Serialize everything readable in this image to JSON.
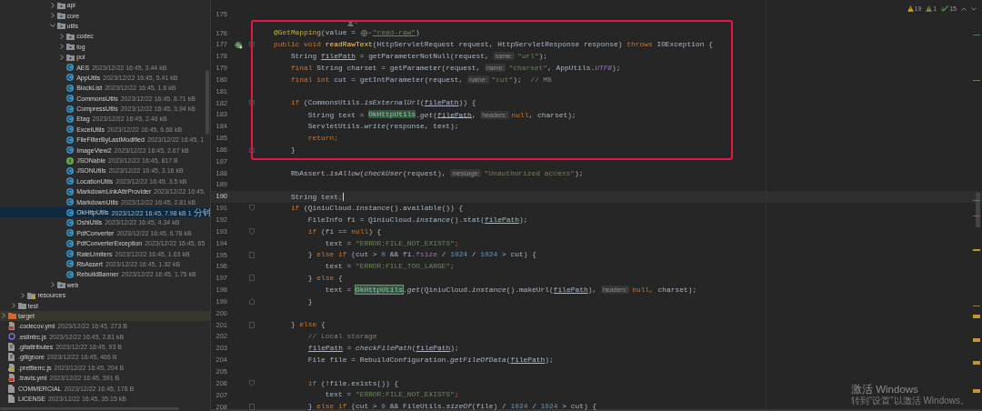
{
  "project_tree": [
    {
      "children": [
        {
          "children": [
            {
              "children": [
                {
                  "children": [
                    {
                      "children": [
                        {
                          "label": "api",
                          "kind": "package",
                          "expanded": false,
                          "selected": false
                        },
                        {
                          "label": "core",
                          "kind": "package",
                          "expanded": false,
                          "selected": false
                        },
                        {
                          "label": "utils",
                          "kind": "package",
                          "expanded": true,
                          "selected": false,
                          "children": [
                            {
                              "label": "codec",
                              "kind": "package",
                              "expanded": false,
                              "selected": false
                            },
                            {
                              "label": "log",
                              "kind": "package",
                              "expanded": false,
                              "selected": false
                            },
                            {
                              "label": "poi",
                              "kind": "package",
                              "expanded": false,
                              "selected": false
                            },
                            {
                              "label": "AES",
                              "meta": "2023/12/22 16:45, 3.44 kB",
                              "kind": "class",
                              "selected": false
                            },
                            {
                              "label": "AppUtils",
                              "meta": "2023/12/22 16:45, 5.41 kB",
                              "kind": "class",
                              "selected": false
                            },
                            {
                              "label": "BlockList",
                              "meta": "2023/12/22 16:45, 1.6 kB",
                              "kind": "class",
                              "selected": false
                            },
                            {
                              "label": "CommonsUtils",
                              "meta": "2023/12/22 16:45, 8.71 kB",
                              "kind": "class",
                              "selected": false
                            },
                            {
                              "label": "CompressUtils",
                              "meta": "2023/12/22 16:45, 3.94 kB",
                              "kind": "class",
                              "selected": false
                            },
                            {
                              "label": "Etag",
                              "meta": "2023/12/22 16:45, 2.46 kB",
                              "kind": "class",
                              "selected": false
                            },
                            {
                              "label": "ExcelUtils",
                              "meta": "2023/12/22 16:45, 6.68 kB",
                              "kind": "class",
                              "selected": false
                            },
                            {
                              "label": "FileFilterByLastModified",
                              "meta": "2023/12/22 16:45, 1",
                              "kind": "class",
                              "selected": false
                            },
                            {
                              "label": "ImageView2",
                              "meta": "2023/12/22 16:45, 2.67 kB",
                              "kind": "class",
                              "selected": false
                            },
                            {
                              "label": "JSONable",
                              "meta": "2023/12/22 16:45, 817 B",
                              "kind": "interface",
                              "selected": false
                            },
                            {
                              "label": "JSONUtils",
                              "meta": "2023/12/22 16:45, 3.16 kB",
                              "kind": "class",
                              "selected": false
                            },
                            {
                              "label": "LocationUtils",
                              "meta": "2023/12/22 16:45, 3.5 kB",
                              "kind": "class",
                              "selected": false
                            },
                            {
                              "label": "MarkdownLinkAttrProvider",
                              "meta": "2023/12/22 16:45,",
                              "kind": "class",
                              "selected": false
                            },
                            {
                              "label": "MarkdownUtils",
                              "meta": "2023/12/22 16:45, 2.81 kB",
                              "kind": "class",
                              "selected": false
                            },
                            {
                              "label": "OkHttpUtils",
                              "meta": "2023/12/22 16:45, 7.98 kB 1 分钟",
                              "kind": "class",
                              "selected": true
                            },
                            {
                              "label": "OshiUtils",
                              "meta": "2023/12/22 16:45, 4.34 kB",
                              "kind": "class",
                              "selected": false
                            },
                            {
                              "label": "PdfConverter",
                              "meta": "2023/12/22 16:45, 6.78 kB",
                              "kind": "class",
                              "selected": false
                            },
                            {
                              "label": "PdfConverterException",
                              "meta": "2023/12/22 16:45, 65",
                              "kind": "class",
                              "selected": false
                            },
                            {
                              "label": "RateLimiters",
                              "meta": "2023/12/22 16:45, 1.63 kB",
                              "kind": "class",
                              "selected": false
                            },
                            {
                              "label": "RbAssert",
                              "meta": "2023/12/22 16:45, 1.32 kB",
                              "kind": "class",
                              "selected": false
                            },
                            {
                              "label": "RebuildBanner",
                              "meta": "2023/12/22 16:45, 1.75 kB",
                              "kind": "class",
                              "selected": false
                            }
                          ]
                        },
                        {
                          "label": "web",
                          "kind": "package",
                          "expanded": false,
                          "selected": false
                        }
                      ]
                    }
                  ]
                }
              ]
            },
            {
              "label": "resources",
              "kind": "resources-folder",
              "expanded": false,
              "selected": false
            }
          ]
        },
        {
          "label": "test",
          "kind": "test-folder",
          "expanded": false,
          "selected": false
        }
      ]
    },
    {
      "label": "target",
      "kind": "excluded-folder",
      "expanded": false,
      "selected": false
    },
    {
      "label": ".codecov.yml",
      "meta": "2023/12/22 16:45, 273 B",
      "kind": "yaml",
      "selected": false
    },
    {
      "label": ".eslintrc.js",
      "meta": "2023/12/22 16:45, 2.81 kB",
      "kind": "eslint",
      "selected": false
    },
    {
      "label": ".gitattributes",
      "meta": "2023/12/22 16:45, 93 B",
      "kind": "git",
      "selected": false
    },
    {
      "label": ".gitignore",
      "meta": "2023/12/22 16:45, 466 B",
      "kind": "git",
      "selected": false
    },
    {
      "label": ".prettierrc.js",
      "meta": "2023/12/22 16:45, 204 B",
      "kind": "prettier",
      "selected": false
    },
    {
      "label": ".travis.yml",
      "meta": "2023/12/22 16:45, 591 B",
      "kind": "yaml",
      "selected": false
    },
    {
      "label": "COMMERCIAL",
      "meta": "2023/12/22 16:45, 178 B",
      "kind": "text",
      "selected": false
    },
    {
      "label": "LICENSE",
      "meta": "2023/12/22 16:45, 35.15 kB",
      "kind": "text",
      "selected": false
    }
  ],
  "inspections": [
    {
      "kind": "warning",
      "count": "19"
    },
    {
      "kind": "weak-warning",
      "count": "1"
    },
    {
      "kind": "typo",
      "count": "15"
    }
  ],
  "editor_lines": [
    {
      "kind": "code",
      "number": "175"
    },
    {
      "kind": "inlay"
    },
    {
      "kind": "highlight-block",
      "lines": [
        {
          "kind": "code",
          "number": "176",
          "tokens": [
            {
              "kind": "ann",
              "text": "    @GetMapping"
            },
            {
              "kind": "plain",
              "text": "(value = "
            },
            {
              "kind": "web-icon"
            },
            {
              "kind": "url",
              "text": "\"read-raw\""
            },
            {
              "kind": "plain",
              "text": ")"
            }
          ]
        },
        {
          "kind": "code",
          "number": "177",
          "endpoint": true,
          "fold_start": true,
          "tokens": [
            {
              "kind": "kw",
              "text": "    public void "
            },
            {
              "kind": "method",
              "text": "readRawText"
            },
            {
              "kind": "plain",
              "text": "(HttpServletRequest request, HttpServletResponse response) "
            },
            {
              "kind": "kw",
              "text": "throws "
            },
            {
              "kind": "plain",
              "text": "IOException {"
            }
          ]
        },
        {
          "kind": "code",
          "number": "178",
          "tokens": [
            {
              "kind": "plain",
              "text": "        String "
            },
            {
              "kind": "var",
              "text": "filePath"
            },
            {
              "kind": "plain",
              "text": " = getParameterNotNull(request, "
            },
            {
              "kind": "hint",
              "text": "name:"
            },
            {
              "kind": "str",
              "text": "\"url\""
            },
            {
              "kind": "plain",
              "text": ");"
            }
          ]
        },
        {
          "kind": "code",
          "number": "179",
          "tokens": [
            {
              "kind": "kw",
              "text": "        final "
            },
            {
              "kind": "plain",
              "text": "String charset = getParameter(request, "
            },
            {
              "kind": "hint",
              "text": "name:"
            },
            {
              "kind": "str",
              "text": "\"charset\""
            },
            {
              "kind": "plain",
              "text": ", AppUtils."
            },
            {
              "kind": "const",
              "text": "UTF8"
            },
            {
              "kind": "plain",
              "text": ");"
            }
          ]
        },
        {
          "kind": "code",
          "number": "180",
          "tokens": [
            {
              "kind": "kw",
              "text": "        final int "
            },
            {
              "kind": "plain",
              "text": "cut = getIntParameter(request, "
            },
            {
              "kind": "hint",
              "text": "name:"
            },
            {
              "kind": "str",
              "text": "\"cut\""
            },
            {
              "kind": "plain",
              "text": ");  "
            },
            {
              "kind": "comment",
              "text": "// MB"
            }
          ]
        },
        {
          "kind": "code",
          "number": "181"
        },
        {
          "kind": "code",
          "number": "182",
          "fold_start": true,
          "tokens": [
            {
              "kind": "kw",
              "text": "        if "
            },
            {
              "kind": "plain",
              "text": "(CommonsUtils."
            },
            {
              "kind": "static",
              "text": "isExternalUrl"
            },
            {
              "kind": "plain",
              "text": "("
            },
            {
              "kind": "var",
              "text": "filePath"
            },
            {
              "kind": "plain",
              "text": ")) {"
            }
          ]
        },
        {
          "kind": "code",
          "number": "183",
          "tokens": [
            {
              "kind": "plain",
              "text": "            String text = "
            },
            {
              "kind": "usage",
              "text": "OkHttpUtils"
            },
            {
              "kind": "plain",
              "text": "."
            },
            {
              "kind": "static",
              "text": "get"
            },
            {
              "kind": "plain",
              "text": "("
            },
            {
              "kind": "var",
              "text": "filePath"
            },
            {
              "kind": "plain",
              "text": ", "
            },
            {
              "kind": "hint",
              "text": "headers:"
            },
            {
              "kind": "kw",
              "text": "null"
            },
            {
              "kind": "plain",
              "text": ", charset);"
            }
          ]
        },
        {
          "kind": "code",
          "number": "184",
          "tokens": [
            {
              "kind": "plain",
              "text": "            ServletUtils."
            },
            {
              "kind": "static",
              "text": "write"
            },
            {
              "kind": "plain",
              "text": "(response, text);"
            }
          ]
        },
        {
          "kind": "code",
          "number": "185",
          "tokens": [
            {
              "kind": "kw",
              "text": "            return;"
            }
          ]
        },
        {
          "kind": "code",
          "number": "186",
          "fold_end": true,
          "tokens": [
            {
              "kind": "plain",
              "text": "        }"
            }
          ]
        }
      ]
    },
    {
      "kind": "code",
      "number": "187"
    },
    {
      "kind": "code",
      "number": "188",
      "tokens": [
        {
          "kind": "plain",
          "text": "        RbAssert."
        },
        {
          "kind": "static",
          "text": "isAllow"
        },
        {
          "kind": "plain",
          "text": "("
        },
        {
          "kind": "static",
          "text": "checkUser"
        },
        {
          "kind": "plain",
          "text": "(request), "
        },
        {
          "kind": "hint",
          "text": "message:"
        },
        {
          "kind": "str",
          "text": "\"Unauthorized access\""
        },
        {
          "kind": "plain",
          "text": ");"
        }
      ]
    },
    {
      "kind": "code",
      "number": "189"
    },
    {
      "kind": "code",
      "number": "190",
      "current": true,
      "tokens": [
        {
          "kind": "plain",
          "text": "        String text"
        },
        {
          "kind": "kw",
          "text": ";"
        }
      ]
    },
    {
      "kind": "code",
      "number": "191",
      "fold_start": true,
      "tokens": [
        {
          "kind": "kw",
          "text": "        if "
        },
        {
          "kind": "plain",
          "text": "(QiniuCloud."
        },
        {
          "kind": "static",
          "text": "instance"
        },
        {
          "kind": "plain",
          "text": "().available()) {"
        }
      ]
    },
    {
      "kind": "code",
      "number": "192",
      "tokens": [
        {
          "kind": "plain",
          "text": "            FileInfo fi = QiniuCloud."
        },
        {
          "kind": "static",
          "text": "instance"
        },
        {
          "kind": "plain",
          "text": "().stat("
        },
        {
          "kind": "var",
          "text": "filePath"
        },
        {
          "kind": "plain",
          "text": ");"
        }
      ]
    },
    {
      "kind": "code",
      "number": "193",
      "fold_start": true,
      "tokens": [
        {
          "kind": "kw",
          "text": "            if "
        },
        {
          "kind": "plain",
          "text": "(fi == "
        },
        {
          "kind": "kw",
          "text": "null"
        },
        {
          "kind": "plain",
          "text": ") {"
        }
      ]
    },
    {
      "kind": "code",
      "number": "194",
      "tokens": [
        {
          "kind": "plain",
          "text": "                text = "
        },
        {
          "kind": "str",
          "text": "\"ERROR:FILE_NOT_EXISTS\""
        },
        {
          "kind": "kw",
          "text": ";"
        }
      ]
    },
    {
      "kind": "code",
      "number": "195",
      "fold_start": true,
      "fold_end": true,
      "tokens": [
        {
          "kind": "plain",
          "text": "            } "
        },
        {
          "kind": "kw",
          "text": "else if "
        },
        {
          "kind": "plain",
          "text": "(cut > "
        },
        {
          "kind": "num",
          "text": "0"
        },
        {
          "kind": "plain",
          "text": " && fi."
        },
        {
          "kind": "field",
          "text": "fsize"
        },
        {
          "kind": "plain",
          "text": " / "
        },
        {
          "kind": "num",
          "text": "1024"
        },
        {
          "kind": "plain",
          "text": " / "
        },
        {
          "kind": "num",
          "text": "1024"
        },
        {
          "kind": "plain",
          "text": " > cut) {"
        }
      ]
    },
    {
      "kind": "code",
      "number": "196",
      "tokens": [
        {
          "kind": "plain",
          "text": "                text = "
        },
        {
          "kind": "str",
          "text": "\"ERROR:FILE_TOO_LARGE\""
        },
        {
          "kind": "kw",
          "text": ";"
        }
      ]
    },
    {
      "kind": "code",
      "number": "197",
      "fold_start": true,
      "fold_end": true,
      "tokens": [
        {
          "kind": "plain",
          "text": "            } "
        },
        {
          "kind": "kw",
          "text": "else "
        },
        {
          "kind": "plain",
          "text": "{"
        }
      ]
    },
    {
      "kind": "code",
      "number": "198",
      "tokens": [
        {
          "kind": "plain",
          "text": "                text = "
        },
        {
          "kind": "usage-caret",
          "text": "OkHttpUtils"
        },
        {
          "kind": "plain",
          "text": "."
        },
        {
          "kind": "static",
          "text": "get"
        },
        {
          "kind": "plain",
          "text": "(QiniuCloud."
        },
        {
          "kind": "static",
          "text": "instance"
        },
        {
          "kind": "plain",
          "text": "().makeUrl("
        },
        {
          "kind": "var",
          "text": "filePath"
        },
        {
          "kind": "plain",
          "text": "), "
        },
        {
          "kind": "hint",
          "text": "headers:"
        },
        {
          "kind": "kw",
          "text": "null, "
        },
        {
          "kind": "plain",
          "text": "charset);"
        }
      ]
    },
    {
      "kind": "code",
      "number": "199",
      "fold_end": true,
      "tokens": [
        {
          "kind": "plain",
          "text": "            }"
        }
      ]
    },
    {
      "kind": "code",
      "number": "200"
    },
    {
      "kind": "code",
      "number": "201",
      "fold_start": true,
      "fold_end": true,
      "tokens": [
        {
          "kind": "plain",
          "text": "        } "
        },
        {
          "kind": "kw",
          "text": "else "
        },
        {
          "kind": "plain",
          "text": "{"
        }
      ]
    },
    {
      "kind": "code",
      "number": "202",
      "tokens": [
        {
          "kind": "comment",
          "text": "            // Local storage"
        }
      ]
    },
    {
      "kind": "code",
      "number": "203",
      "tokens": [
        {
          "kind": "var-indented",
          "text": "filePath"
        },
        {
          "kind": "plain",
          "text": " = "
        },
        {
          "kind": "static",
          "text": "checkFilePath"
        },
        {
          "kind": "plain",
          "text": "("
        },
        {
          "kind": "var",
          "text": "filePath"
        },
        {
          "kind": "plain",
          "text": ");"
        }
      ]
    },
    {
      "kind": "code",
      "number": "204",
      "tokens": [
        {
          "kind": "plain",
          "text": "            File file = RebuildConfiguration."
        },
        {
          "kind": "static",
          "text": "getFileOfData"
        },
        {
          "kind": "plain",
          "text": "("
        },
        {
          "kind": "var",
          "text": "filePath"
        },
        {
          "kind": "plain",
          "text": ");"
        }
      ]
    },
    {
      "kind": "code",
      "number": "205"
    },
    {
      "kind": "code",
      "number": "206",
      "fold_start": true,
      "tokens": [
        {
          "kind": "kw",
          "text": "            if "
        },
        {
          "kind": "plain",
          "text": "(!file.exists()) {"
        }
      ]
    },
    {
      "kind": "code",
      "number": "207",
      "tokens": [
        {
          "kind": "plain",
          "text": "                text = "
        },
        {
          "kind": "str",
          "text": "\"ERROR:FILE_NOT_EXISTS\""
        },
        {
          "kind": "kw",
          "text": ";"
        }
      ]
    },
    {
      "kind": "code",
      "number": "208",
      "fold_start": true,
      "fold_end": true,
      "tokens": [
        {
          "kind": "plain",
          "text": "            } "
        },
        {
          "kind": "kw",
          "text": "else if "
        },
        {
          "kind": "plain",
          "text": "(cut > "
        },
        {
          "kind": "num",
          "text": "0"
        },
        {
          "kind": "plain",
          "text": " && FileUtils."
        },
        {
          "kind": "static",
          "text": "sizeOf"
        },
        {
          "kind": "plain",
          "text": "(file) / "
        },
        {
          "kind": "num",
          "text": "1024"
        },
        {
          "kind": "plain",
          "text": " / "
        },
        {
          "kind": "num",
          "text": "1024"
        },
        {
          "kind": "plain",
          "text": " > cut) {"
        }
      ]
    }
  ],
  "activation_notice": {
    "title": "激活 Windows",
    "subtitle": "转到“设置”以激活 Windows。"
  }
}
